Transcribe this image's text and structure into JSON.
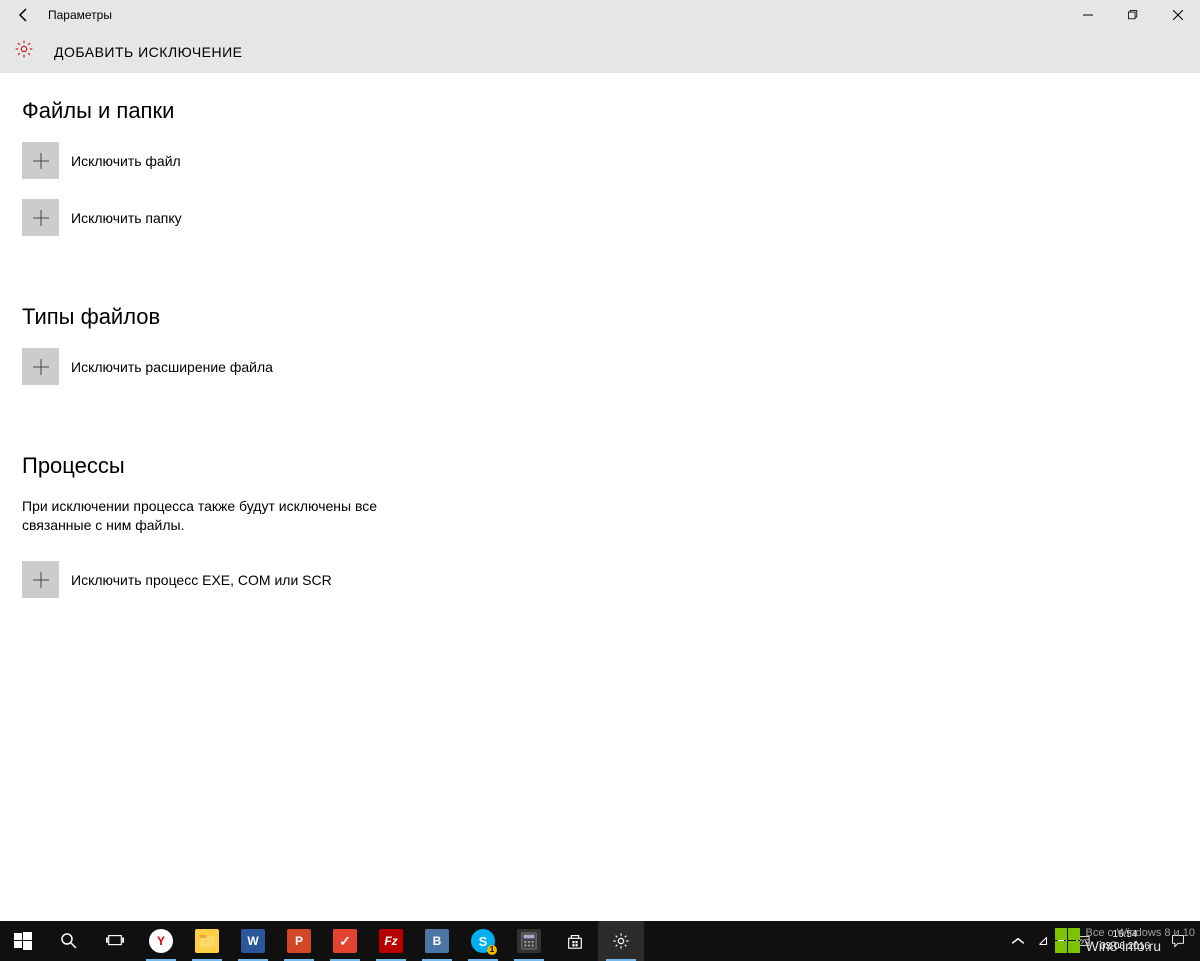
{
  "window": {
    "title": "Параметры",
    "heading": "ДОБАВИТЬ ИСКЛЮЧЕНИЕ"
  },
  "sections": {
    "files": {
      "title": "Файлы и папки",
      "file_btn": "Исключить файл",
      "folder_btn": "Исключить папку"
    },
    "types": {
      "title": "Типы файлов",
      "ext_btn": "Исключить расширение файла"
    },
    "processes": {
      "title": "Процессы",
      "desc": "При исключении процесса также будут исключены все связанные с ним файлы.",
      "proc_btn": "Исключить процесс EXE, COM или SCR"
    }
  },
  "tray": {
    "time": "16:54",
    "date": "03.06.2016"
  },
  "watermark": {
    "line1": "Все о Windows 8 и 10",
    "line2": "Win8-info.ru"
  }
}
